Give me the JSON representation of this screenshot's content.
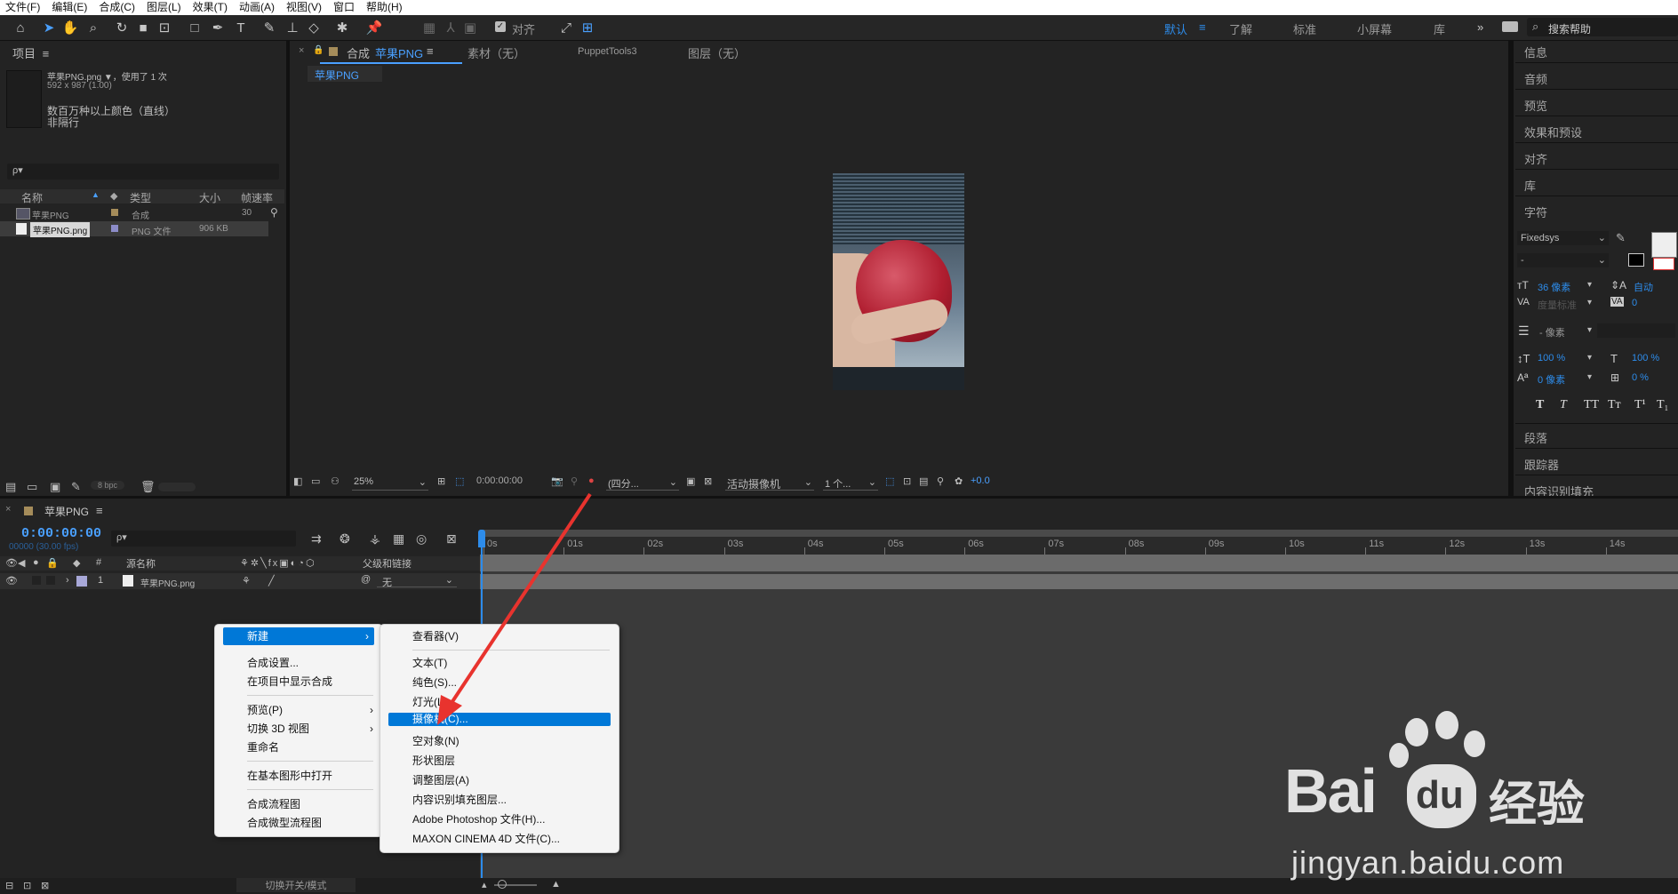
{
  "menubar": [
    "文件(F)",
    "编辑(E)",
    "合成(C)",
    "图层(L)",
    "效果(T)",
    "动画(A)",
    "视图(V)",
    "窗口",
    "帮助(H)"
  ],
  "toolbar": {
    "snap_label": "对齐",
    "workspaces": [
      "默认",
      "了解",
      "标准",
      "小屏幕",
      "库"
    ],
    "search_placeholder": "搜索帮助"
  },
  "project": {
    "title": "项目",
    "item_name": "苹果PNG.png ▼，使用了 1 次",
    "item_size": "592 x 987 (1.00)",
    "item_color": "数百万种以上颜色（直线）",
    "item_interlace": "非隔行",
    "search_glyph": "ρ▾",
    "columns": [
      "名称",
      "类型",
      "大小",
      "帧速率"
    ],
    "rows": [
      {
        "name": "苹果PNG",
        "type": "合成",
        "size": "",
        "fps": "30",
        "color": "#a58c5a"
      },
      {
        "name": "苹果PNG.png",
        "type": "PNG 文件",
        "size": "906 KB",
        "fps": "",
        "color": "#8c8cc8"
      }
    ],
    "bpc": "8 bpc"
  },
  "viewer": {
    "tabs": [
      "合成",
      "苹果PNG",
      "素材（无）",
      "PuppetTools3",
      "图层（无）"
    ],
    "subtab": "苹果PNG",
    "zoom": "25%",
    "timecode": "0:00:00:00",
    "resolution": "(四分...",
    "camera": "活动摄像机",
    "views": "1 个...",
    "exposure": "+0.0"
  },
  "right_panel": {
    "items_top": [
      "信息",
      "音频",
      "预览",
      "效果和预设",
      "对齐",
      "库",
      "字符"
    ],
    "font_family": "Fixedsys",
    "font_style": "-",
    "font_size": "36 像素",
    "leading": "自动",
    "kerning": "度量标准",
    "tracking": "0",
    "stroke": "- 像素",
    "vscale": "100 %",
    "hscale": "100 %",
    "baseline": "0 像素",
    "tsume": "0 %",
    "type_buttons": [
      "T",
      "T",
      "TT",
      "Tт",
      "T¹",
      "T₁"
    ],
    "items_bottom": [
      "段落",
      "跟踪器",
      "内容识别填充"
    ]
  },
  "timeline": {
    "comp_tab": "苹果PNG",
    "timecode": "0:00:00:00",
    "fps_label": "00000 (30.00 fps)",
    "col_source": "源名称",
    "col_parent": "父级和链接",
    "layer_num": "1",
    "layer_name": "苹果PNG.png",
    "layer_parent": "无",
    "ticks": [
      "0s",
      "01s",
      "02s",
      "03s",
      "04s",
      "05s",
      "06s",
      "07s",
      "08s",
      "09s",
      "10s",
      "11s",
      "12s",
      "13s",
      "14s"
    ],
    "footer": "切换开关/模式"
  },
  "context_menu": {
    "items": [
      "新建",
      "合成设置...",
      "在项目中显示合成",
      "预览(P)",
      "切换 3D 视图",
      "重命名",
      "在基本图形中打开",
      "合成流程图",
      "合成微型流程图"
    ]
  },
  "submenu": {
    "items": [
      "查看器(V)",
      "文本(T)",
      "纯色(S)...",
      "灯光(L)...",
      "摄像机(C)...",
      "空对象(N)",
      "形状图层",
      "调整图层(A)",
      "内容识别填充图层...",
      "Adobe Photoshop 文件(H)...",
      "MAXON CINEMA 4D 文件(C)..."
    ],
    "selected": "摄像机(C)..."
  },
  "watermark": {
    "brand": "Bai",
    "brand2": "du",
    "cn": "经验",
    "url": "jingyan.baidu.com"
  },
  "colors": {
    "accent": "#2d8ceb",
    "menu_select": "#0078d7",
    "arrow": "#e8332e"
  }
}
